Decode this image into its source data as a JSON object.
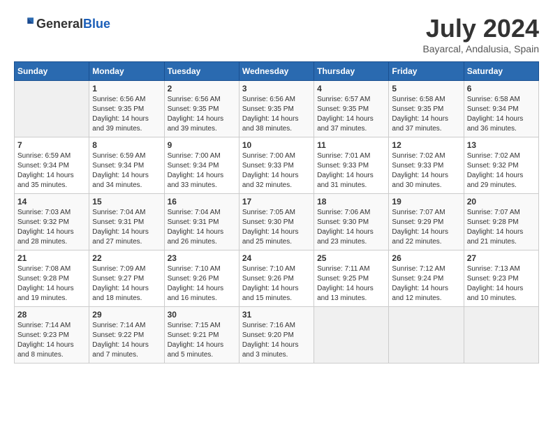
{
  "header": {
    "logo_general": "General",
    "logo_blue": "Blue",
    "month_year": "July 2024",
    "location": "Bayarcal, Andalusia, Spain"
  },
  "days_of_week": [
    "Sunday",
    "Monday",
    "Tuesday",
    "Wednesday",
    "Thursday",
    "Friday",
    "Saturday"
  ],
  "weeks": [
    [
      {
        "day": "",
        "sunrise": "",
        "sunset": "",
        "daylight": ""
      },
      {
        "day": "1",
        "sunrise": "Sunrise: 6:56 AM",
        "sunset": "Sunset: 9:35 PM",
        "daylight": "Daylight: 14 hours and 39 minutes."
      },
      {
        "day": "2",
        "sunrise": "Sunrise: 6:56 AM",
        "sunset": "Sunset: 9:35 PM",
        "daylight": "Daylight: 14 hours and 39 minutes."
      },
      {
        "day": "3",
        "sunrise": "Sunrise: 6:56 AM",
        "sunset": "Sunset: 9:35 PM",
        "daylight": "Daylight: 14 hours and 38 minutes."
      },
      {
        "day": "4",
        "sunrise": "Sunrise: 6:57 AM",
        "sunset": "Sunset: 9:35 PM",
        "daylight": "Daylight: 14 hours and 37 minutes."
      },
      {
        "day": "5",
        "sunrise": "Sunrise: 6:58 AM",
        "sunset": "Sunset: 9:35 PM",
        "daylight": "Daylight: 14 hours and 37 minutes."
      },
      {
        "day": "6",
        "sunrise": "Sunrise: 6:58 AM",
        "sunset": "Sunset: 9:34 PM",
        "daylight": "Daylight: 14 hours and 36 minutes."
      }
    ],
    [
      {
        "day": "7",
        "sunrise": "Sunrise: 6:59 AM",
        "sunset": "Sunset: 9:34 PM",
        "daylight": "Daylight: 14 hours and 35 minutes."
      },
      {
        "day": "8",
        "sunrise": "Sunrise: 6:59 AM",
        "sunset": "Sunset: 9:34 PM",
        "daylight": "Daylight: 14 hours and 34 minutes."
      },
      {
        "day": "9",
        "sunrise": "Sunrise: 7:00 AM",
        "sunset": "Sunset: 9:34 PM",
        "daylight": "Daylight: 14 hours and 33 minutes."
      },
      {
        "day": "10",
        "sunrise": "Sunrise: 7:00 AM",
        "sunset": "Sunset: 9:33 PM",
        "daylight": "Daylight: 14 hours and 32 minutes."
      },
      {
        "day": "11",
        "sunrise": "Sunrise: 7:01 AM",
        "sunset": "Sunset: 9:33 PM",
        "daylight": "Daylight: 14 hours and 31 minutes."
      },
      {
        "day": "12",
        "sunrise": "Sunrise: 7:02 AM",
        "sunset": "Sunset: 9:33 PM",
        "daylight": "Daylight: 14 hours and 30 minutes."
      },
      {
        "day": "13",
        "sunrise": "Sunrise: 7:02 AM",
        "sunset": "Sunset: 9:32 PM",
        "daylight": "Daylight: 14 hours and 29 minutes."
      }
    ],
    [
      {
        "day": "14",
        "sunrise": "Sunrise: 7:03 AM",
        "sunset": "Sunset: 9:32 PM",
        "daylight": "Daylight: 14 hours and 28 minutes."
      },
      {
        "day": "15",
        "sunrise": "Sunrise: 7:04 AM",
        "sunset": "Sunset: 9:31 PM",
        "daylight": "Daylight: 14 hours and 27 minutes."
      },
      {
        "day": "16",
        "sunrise": "Sunrise: 7:04 AM",
        "sunset": "Sunset: 9:31 PM",
        "daylight": "Daylight: 14 hours and 26 minutes."
      },
      {
        "day": "17",
        "sunrise": "Sunrise: 7:05 AM",
        "sunset": "Sunset: 9:30 PM",
        "daylight": "Daylight: 14 hours and 25 minutes."
      },
      {
        "day": "18",
        "sunrise": "Sunrise: 7:06 AM",
        "sunset": "Sunset: 9:30 PM",
        "daylight": "Daylight: 14 hours and 23 minutes."
      },
      {
        "day": "19",
        "sunrise": "Sunrise: 7:07 AM",
        "sunset": "Sunset: 9:29 PM",
        "daylight": "Daylight: 14 hours and 22 minutes."
      },
      {
        "day": "20",
        "sunrise": "Sunrise: 7:07 AM",
        "sunset": "Sunset: 9:28 PM",
        "daylight": "Daylight: 14 hours and 21 minutes."
      }
    ],
    [
      {
        "day": "21",
        "sunrise": "Sunrise: 7:08 AM",
        "sunset": "Sunset: 9:28 PM",
        "daylight": "Daylight: 14 hours and 19 minutes."
      },
      {
        "day": "22",
        "sunrise": "Sunrise: 7:09 AM",
        "sunset": "Sunset: 9:27 PM",
        "daylight": "Daylight: 14 hours and 18 minutes."
      },
      {
        "day": "23",
        "sunrise": "Sunrise: 7:10 AM",
        "sunset": "Sunset: 9:26 PM",
        "daylight": "Daylight: 14 hours and 16 minutes."
      },
      {
        "day": "24",
        "sunrise": "Sunrise: 7:10 AM",
        "sunset": "Sunset: 9:26 PM",
        "daylight": "Daylight: 14 hours and 15 minutes."
      },
      {
        "day": "25",
        "sunrise": "Sunrise: 7:11 AM",
        "sunset": "Sunset: 9:25 PM",
        "daylight": "Daylight: 14 hours and 13 minutes."
      },
      {
        "day": "26",
        "sunrise": "Sunrise: 7:12 AM",
        "sunset": "Sunset: 9:24 PM",
        "daylight": "Daylight: 14 hours and 12 minutes."
      },
      {
        "day": "27",
        "sunrise": "Sunrise: 7:13 AM",
        "sunset": "Sunset: 9:23 PM",
        "daylight": "Daylight: 14 hours and 10 minutes."
      }
    ],
    [
      {
        "day": "28",
        "sunrise": "Sunrise: 7:14 AM",
        "sunset": "Sunset: 9:23 PM",
        "daylight": "Daylight: 14 hours and 8 minutes."
      },
      {
        "day": "29",
        "sunrise": "Sunrise: 7:14 AM",
        "sunset": "Sunset: 9:22 PM",
        "daylight": "Daylight: 14 hours and 7 minutes."
      },
      {
        "day": "30",
        "sunrise": "Sunrise: 7:15 AM",
        "sunset": "Sunset: 9:21 PM",
        "daylight": "Daylight: 14 hours and 5 minutes."
      },
      {
        "day": "31",
        "sunrise": "Sunrise: 7:16 AM",
        "sunset": "Sunset: 9:20 PM",
        "daylight": "Daylight: 14 hours and 3 minutes."
      },
      {
        "day": "",
        "sunrise": "",
        "sunset": "",
        "daylight": ""
      },
      {
        "day": "",
        "sunrise": "",
        "sunset": "",
        "daylight": ""
      },
      {
        "day": "",
        "sunrise": "",
        "sunset": "",
        "daylight": ""
      }
    ]
  ]
}
